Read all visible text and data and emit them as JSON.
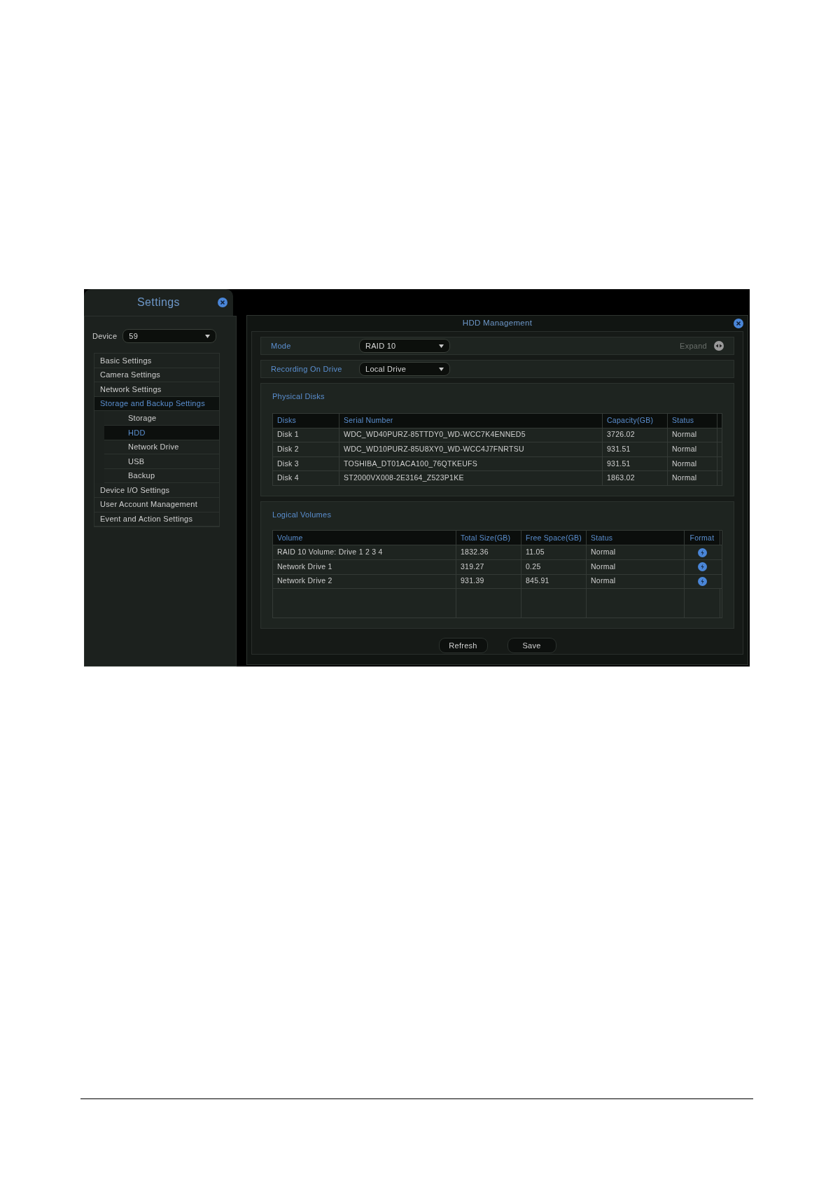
{
  "settings": {
    "title": "Settings",
    "device_label": "Device",
    "device_value": "59",
    "menu": [
      {
        "label": "Basic Settings",
        "selected": false
      },
      {
        "label": "Camera Settings",
        "selected": false
      },
      {
        "label": "Network Settings",
        "selected": false
      },
      {
        "label": "Storage and Backup Settings",
        "selected": true,
        "children": [
          {
            "label": "Storage",
            "selected": false
          },
          {
            "label": "HDD",
            "selected": true
          },
          {
            "label": "Network Drive",
            "selected": false
          },
          {
            "label": "USB",
            "selected": false
          },
          {
            "label": "Backup",
            "selected": false
          }
        ]
      },
      {
        "label": "Device I/O Settings",
        "selected": false
      },
      {
        "label": "User Account Management",
        "selected": false
      },
      {
        "label": "Event and Action Settings",
        "selected": false
      }
    ]
  },
  "hdd": {
    "title": "HDD Management",
    "mode": {
      "label": "Mode",
      "value": "RAID 10",
      "expand": "Expand"
    },
    "recording": {
      "label": "Recording On Drive",
      "value": "Local Drive"
    },
    "physical": {
      "title": "Physical Disks",
      "columns": [
        "Disks",
        "Serial Number",
        "Capacity(GB)",
        "Status"
      ],
      "rows": [
        [
          "Disk 1",
          "WDC_WD40PURZ-85TTDY0_WD-WCC7K4ENNED5",
          "3726.02",
          "Normal"
        ],
        [
          "Disk 2",
          "WDC_WD10PURZ-85U8XY0_WD-WCC4J7FNRTSU",
          "931.51",
          "Normal"
        ],
        [
          "Disk 3",
          "TOSHIBA_DT01ACA100_76QTKEUFS",
          "931.51",
          "Normal"
        ],
        [
          "Disk 4",
          "ST2000VX008-2E3164_Z523P1KE",
          "1863.02",
          "Normal"
        ]
      ]
    },
    "logical": {
      "title": "Logical Volumes",
      "columns": [
        "Volume",
        "Total Size(GB)",
        "Free Space(GB)",
        "Status",
        "Format"
      ],
      "rows": [
        [
          "RAID 10 Volume: Drive 1 2 3 4",
          "1832.36",
          "11.05",
          "Normal"
        ],
        [
          "Network Drive 1",
          "319.27",
          "0.25",
          "Normal"
        ],
        [
          "Network Drive 2",
          "931.39",
          "845.91",
          "Normal"
        ]
      ]
    },
    "buttons": [
      "Refresh",
      "Save"
    ]
  }
}
